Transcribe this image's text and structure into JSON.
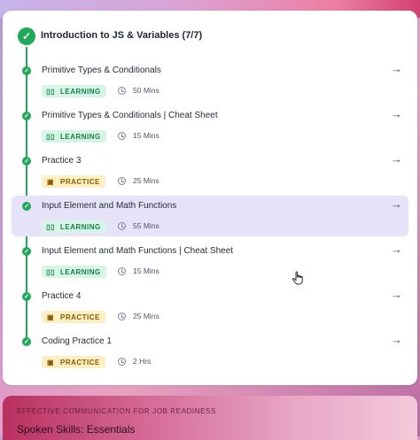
{
  "module": {
    "title": "Introduction to JS & Variables (7/7)"
  },
  "items": [
    {
      "title": "Primitive Types & Conditionals",
      "badge": "LEARNING",
      "duration": "50 Mins"
    },
    {
      "title": "Primitive Types & Conditionals | Cheat Sheet",
      "badge": "LEARNING",
      "duration": "15 Mins"
    },
    {
      "title": "Practice 3",
      "badge": "PRACTICE",
      "duration": "25 Mins"
    },
    {
      "title": "Input Element and Math Functions",
      "badge": "LEARNING",
      "duration": "55 Mins"
    },
    {
      "title": "Input Element and Math Functions | Cheat Sheet",
      "badge": "LEARNING",
      "duration": "15 Mins"
    },
    {
      "title": "Practice 4",
      "badge": "PRACTICE",
      "duration": "25 Mins"
    },
    {
      "title": "Coding Practice 1",
      "badge": "PRACTICE",
      "duration": "2 Hrs"
    }
  ],
  "next_course": {
    "eyebrow": "EFFECTIVE COMMUNICATION FOR JOB READINESS",
    "title": "Spoken Skills: Essentials"
  },
  "icons": {
    "completed": "check-circle-icon",
    "learning": "book-icon",
    "practice": "clipboard-icon",
    "duration": "clock-icon",
    "open": "arrow-right-icon"
  },
  "colors": {
    "success": "#1fa958",
    "learning_bg": "#d7f5e7",
    "practice_bg": "#fbefc4",
    "highlight_bg": "#e6e3f8"
  }
}
